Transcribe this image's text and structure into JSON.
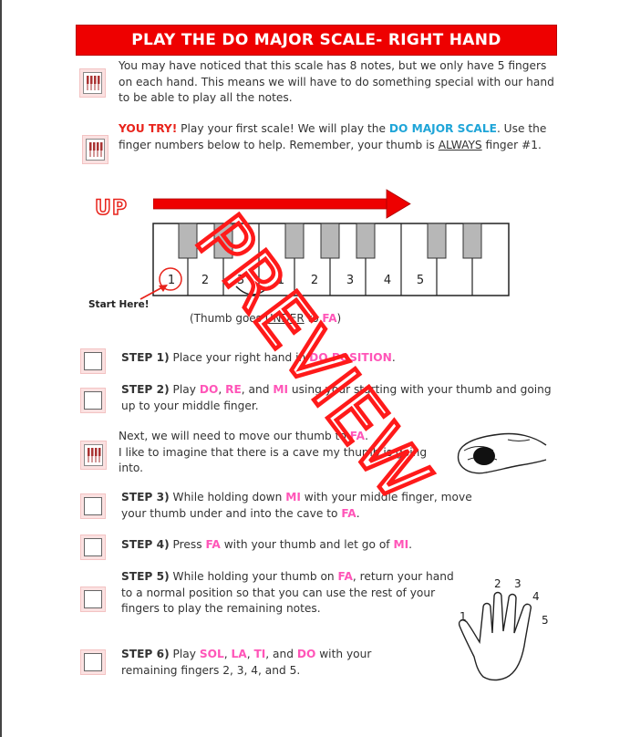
{
  "title": "PLAY THE DO MAJOR SCALE- RIGHT HAND",
  "intro": {
    "text": "You may have noticed that this scale has 8 notes, but we only have 5 fingers on each hand. This means we will have to do something special with our hand to be able to play all the notes."
  },
  "you_try": {
    "label": "YOU TRY!",
    "part1": " Play your first scale! We will play the ",
    "scale": "DO MAJOR SCALE",
    "part2": ". Use the finger numbers below to help. Remember, your thumb is ",
    "always": "ALWAYS",
    "part3": " finger #1."
  },
  "diagram": {
    "up_label": "UP",
    "finger_numbers": [
      "1",
      "2",
      "3",
      "1",
      "2",
      "3",
      "4",
      "5"
    ],
    "start_here": "Start Here!",
    "caption_pre": "(Thumb goes ",
    "caption_under": "UNDER",
    "caption_mid": " to ",
    "caption_fa": "FA",
    "caption_post": ")"
  },
  "watermark": "PREVIEW",
  "steps": {
    "step1": {
      "label": "STEP 1)",
      "t1": " Place your right hand in ",
      "note": "DO POSITION",
      "t2": "."
    },
    "step2": {
      "label": "STEP 2)",
      "t1": " Play ",
      "n1": "DO",
      "t2": ", ",
      "n2": "RE",
      "t3": ", and ",
      "n3": "MI",
      "t4": " using your starting with your thumb and going up to your middle finger."
    },
    "next": {
      "t1": "Next, we will need to move our thumb to ",
      "n1": "FA",
      "t2": ".",
      "t3": "I like to imagine that there is a cave my thumb is going into."
    },
    "step3": {
      "label": "STEP 3)",
      "t1": " While holding down ",
      "n1": "MI",
      "t2": " with your middle finger, move your thumb under and into the cave to ",
      "n2": "FA",
      "t3": "."
    },
    "step4": {
      "label": "STEP 4)",
      "t1": " Press ",
      "n1": "FA",
      "t2": " with your thumb and let go of ",
      "n2": "MI",
      "t3": "."
    },
    "step5": {
      "label": "STEP 5)",
      "t1": " While holding your thumb on ",
      "n1": "FA",
      "t2": ", return your hand to a normal position so that you can use the rest of your fingers to play the remaining notes."
    },
    "step6": {
      "label": "STEP 6)",
      "t1": " Play ",
      "n1": "SOL",
      "t2": ", ",
      "n2": "LA",
      "t3": ", ",
      "n3": "TI",
      "t4": ", and ",
      "n4": "DO",
      "t5": " with your remaining fingers 2, 3, 4, and 5."
    }
  },
  "hand_numbers": [
    "1",
    "2",
    "3",
    "4",
    "5"
  ],
  "colors": {
    "accent_red": "#ee0000",
    "note_pink": "#ff55b8",
    "scale_blue": "#1fa5d8"
  }
}
